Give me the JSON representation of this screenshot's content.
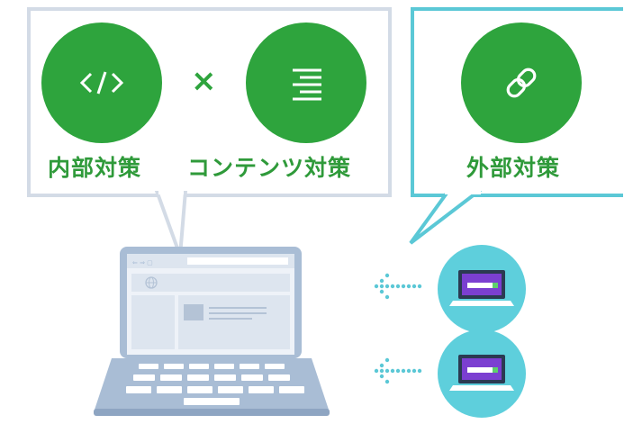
{
  "internal": {
    "label": "内部対策"
  },
  "times_symbol": "×",
  "content": {
    "label": "コンテンツ対策"
  },
  "external": {
    "label": "外部対策"
  },
  "icons": {
    "code": "code-icon",
    "text_lines": "text-align-icon",
    "link": "link-icon",
    "globe": "globe-icon",
    "laptop": "laptop-icon"
  },
  "colors": {
    "green": "#2ea43d",
    "label_green": "#2f9a3a",
    "teal": "#5bc8d6",
    "bubble_border_gray": "#d3dbe6",
    "laptop_blue": "#a9bdd5",
    "purple": "#7b3fd1"
  }
}
